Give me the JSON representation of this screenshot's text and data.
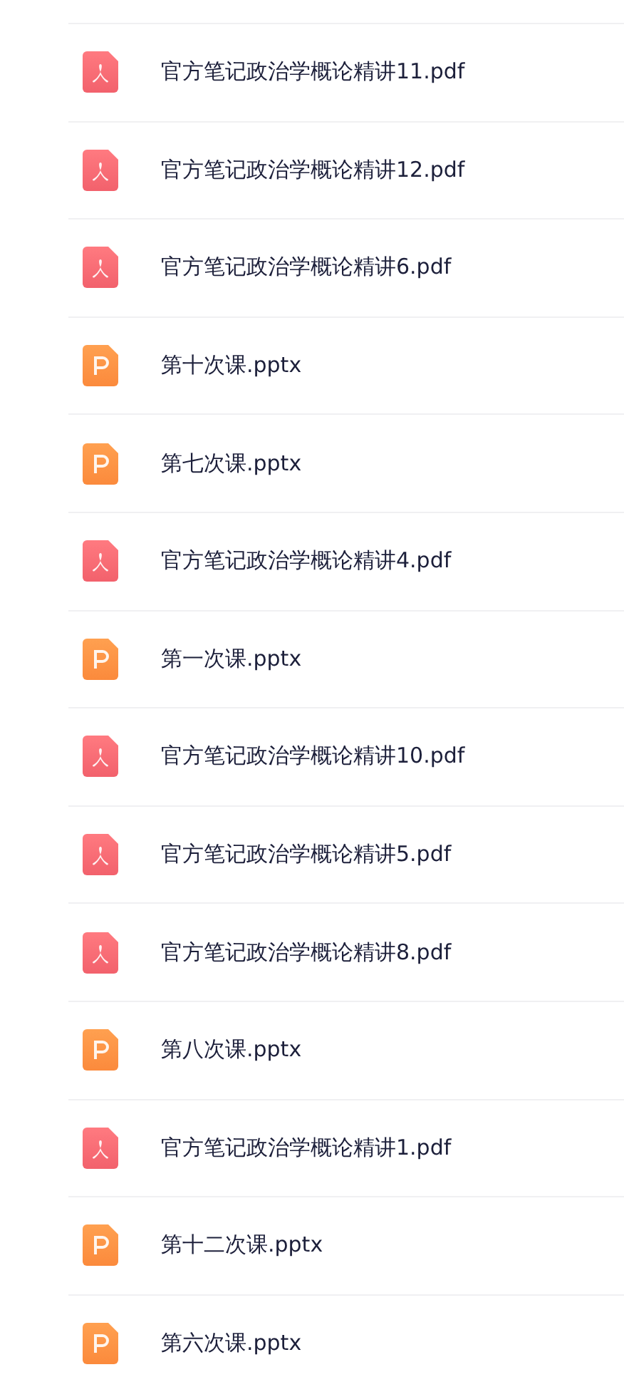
{
  "files": [
    {
      "kind": "pdf",
      "name": "官方笔记政治学概论精讲11.pdf"
    },
    {
      "kind": "pdf",
      "name": "官方笔记政治学概论精讲12.pdf"
    },
    {
      "kind": "pdf",
      "name": "官方笔记政治学概论精讲6.pdf"
    },
    {
      "kind": "pptx",
      "name": "第十次课.pptx"
    },
    {
      "kind": "pptx",
      "name": "第七次课.pptx"
    },
    {
      "kind": "pdf",
      "name": "官方笔记政治学概论精讲4.pdf"
    },
    {
      "kind": "pptx",
      "name": "第一次课.pptx"
    },
    {
      "kind": "pdf",
      "name": "官方笔记政治学概论精讲10.pdf"
    },
    {
      "kind": "pdf",
      "name": "官方笔记政治学概论精讲5.pdf"
    },
    {
      "kind": "pdf",
      "name": "官方笔记政治学概论精讲8.pdf"
    },
    {
      "kind": "pptx",
      "name": "第八次课.pptx"
    },
    {
      "kind": "pdf",
      "name": "官方笔记政治学概论精讲1.pdf"
    },
    {
      "kind": "pptx",
      "name": "第十二次课.pptx"
    },
    {
      "kind": "pptx",
      "name": "第六次课.pptx"
    }
  ]
}
